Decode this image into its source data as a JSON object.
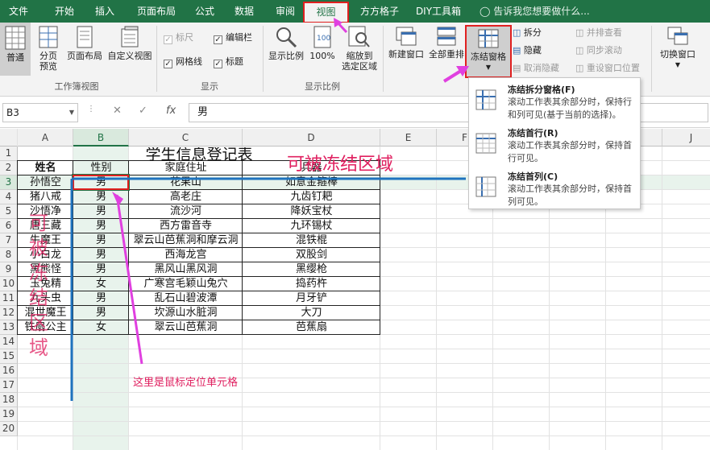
{
  "tabs": [
    "文件",
    "开始",
    "插入",
    "页面布局",
    "公式",
    "数据",
    "审阅",
    "视图",
    "方方格子",
    "DIY工具箱"
  ],
  "tell_me": "告诉我您想要做什么...",
  "ribbon": {
    "workbook_views": {
      "normal": "普通",
      "page_break": "分页\n预览",
      "page_layout": "页面布局",
      "custom": "自定义视图",
      "group": "工作簿视图"
    },
    "show": {
      "ruler": "标尺",
      "formula_bar": "编辑栏",
      "gridlines": "网格线",
      "headings": "标题",
      "group": "显示"
    },
    "zoom": {
      "zoom": "显示比例",
      "zoom100": "100%",
      "zoom_sel": "缩放到\n选定区域",
      "group": "显示比例"
    },
    "window": {
      "new_window": "新建窗口",
      "arrange_all": "全部重排",
      "freeze": "冻结窗格",
      "split": "拆分",
      "hide": "隐藏",
      "unhide": "取消隐藏",
      "side_by_side": "并排查看",
      "sync_scroll": "同步滚动",
      "reset_pos": "重设窗口位置",
      "switch": "切换窗口"
    }
  },
  "formula_bar": {
    "name_box": "B3",
    "fx": "fx",
    "value": "男"
  },
  "columns": [
    "A",
    "B",
    "C",
    "D",
    "E",
    "F",
    "G",
    "H",
    "I",
    "J"
  ],
  "rows": [
    "1",
    "2",
    "3",
    "4",
    "5",
    "6",
    "7",
    "8",
    "9",
    "10",
    "11",
    "12",
    "13",
    "14",
    "15",
    "16",
    "17",
    "18",
    "19",
    "20"
  ],
  "sheet": {
    "title": "学生信息登记表",
    "headers": [
      "姓名",
      "性别",
      "家庭住址",
      "兵器"
    ],
    "data": [
      [
        "孙悟空",
        "男",
        "花果山",
        "如意金箍棒"
      ],
      [
        "猪八戒",
        "男",
        "高老庄",
        "九齿钉耙"
      ],
      [
        "沙悟净",
        "男",
        "流沙河",
        "降妖宝杖"
      ],
      [
        "唐三藏",
        "男",
        "西方雷音寺",
        "九环锡杖"
      ],
      [
        "牛魔王",
        "男",
        "翠云山芭蕉洞和摩云洞",
        "混铁棍"
      ],
      [
        "小白龙",
        "男",
        "西海龙宫",
        "双股剑"
      ],
      [
        "黑熊怪",
        "男",
        "黑风山黑风洞",
        "黑缨枪"
      ],
      [
        "玉兔精",
        "女",
        "广寒宫毛颖山兔穴",
        "捣药杵"
      ],
      [
        "九头虫",
        "男",
        "乱石山碧波潭",
        "月牙铲"
      ],
      [
        "混世魔王",
        "男",
        "坎源山水脏洞",
        "大刀"
      ],
      [
        "铁扇公主",
        "女",
        "翠云山芭蕉洞",
        "芭蕉扇"
      ]
    ]
  },
  "freeze_menu": [
    {
      "title": "冻结拆分窗格(F)",
      "desc": "滚动工作表其余部分时，保持行和列可见(基于当前的选择)。"
    },
    {
      "title": "冻结首行(R)",
      "desc": "滚动工作表其余部分时，保持首行可见。"
    },
    {
      "title": "冻结首列(C)",
      "desc": "滚动工作表其余部分时，保持首列可见。"
    }
  ],
  "annotations": {
    "frozen_right": "可被冻结区域",
    "frozen_left": "可被冻结区域",
    "cursor_note": "这里是鼠标定位单元格"
  },
  "colors": {
    "accent": "#217346",
    "annotation": "#e02060",
    "freeze_line": "#1e73be"
  }
}
